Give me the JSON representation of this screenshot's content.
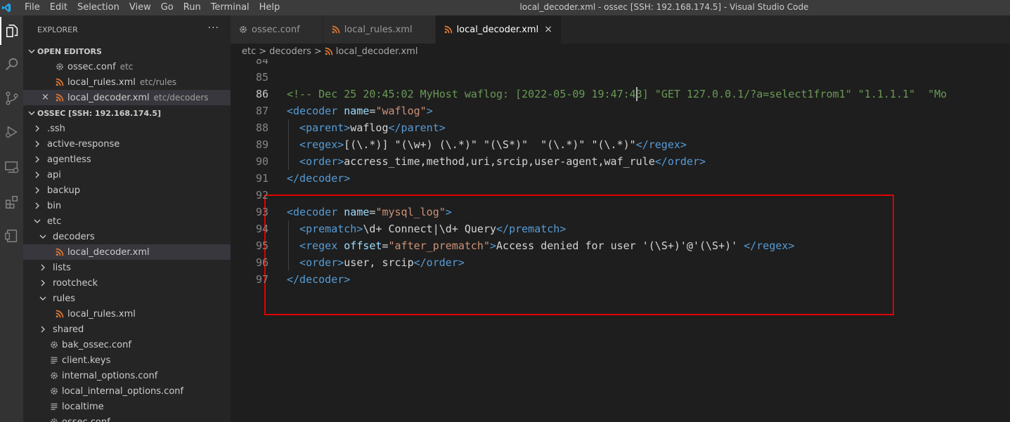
{
  "window": {
    "title": "local_decoder.xml - ossec [SSH: 192.168.174.5] - Visual Studio Code",
    "menu": [
      "File",
      "Edit",
      "Selection",
      "View",
      "Go",
      "Run",
      "Terminal",
      "Help"
    ]
  },
  "activity_bar": {
    "icons": [
      "explorer-icon",
      "search-icon",
      "source-control-icon",
      "run-debug-icon",
      "remote-explorer-icon",
      "extensions-icon",
      "remote-icon"
    ]
  },
  "sidebar": {
    "title": "EXPLORER",
    "more_actions": "···",
    "open_editors": {
      "label": "OPEN EDITORS",
      "items": [
        {
          "name": "ossec.conf",
          "desc": "etc",
          "icon": "gear-icon"
        },
        {
          "name": "local_rules.xml",
          "desc": "etc/rules",
          "icon": "rss-icon"
        },
        {
          "name": "local_decoder.xml",
          "desc": "etc/decoders",
          "icon": "rss-icon"
        }
      ]
    },
    "workspace": {
      "label": "OSSEC [SSH: 192.168.174.5]",
      "items": [
        {
          "name": ".ssh",
          "depth": 1,
          "type": "folder",
          "open": false
        },
        {
          "name": "active-response",
          "depth": 1,
          "type": "folder",
          "open": false
        },
        {
          "name": "agentless",
          "depth": 1,
          "type": "folder",
          "open": false
        },
        {
          "name": "api",
          "depth": 1,
          "type": "folder",
          "open": false
        },
        {
          "name": "backup",
          "depth": 1,
          "type": "folder",
          "open": false
        },
        {
          "name": "bin",
          "depth": 1,
          "type": "folder",
          "open": false
        },
        {
          "name": "etc",
          "depth": 1,
          "type": "folder",
          "open": true
        },
        {
          "name": "decoders",
          "depth": 2,
          "type": "folder",
          "open": true
        },
        {
          "name": "local_decoder.xml",
          "depth": 3,
          "type": "file",
          "icon": "rss-icon",
          "selected": true
        },
        {
          "name": "lists",
          "depth": 2,
          "type": "folder",
          "open": false
        },
        {
          "name": "rootcheck",
          "depth": 2,
          "type": "folder",
          "open": false
        },
        {
          "name": "rules",
          "depth": 2,
          "type": "folder",
          "open": true
        },
        {
          "name": "local_rules.xml",
          "depth": 3,
          "type": "file",
          "icon": "rss-icon"
        },
        {
          "name": "shared",
          "depth": 2,
          "type": "folder",
          "open": false
        },
        {
          "name": "bak_ossec.conf",
          "depth": 2,
          "type": "file",
          "icon": "gear-icon"
        },
        {
          "name": "client.keys",
          "depth": 2,
          "type": "file",
          "icon": "lines-icon"
        },
        {
          "name": "internal_options.conf",
          "depth": 2,
          "type": "file",
          "icon": "gear-icon"
        },
        {
          "name": "local_internal_options.conf",
          "depth": 2,
          "type": "file",
          "icon": "gear-icon"
        },
        {
          "name": "localtime",
          "depth": 2,
          "type": "file",
          "icon": "lines-icon"
        },
        {
          "name": "ossec.conf",
          "depth": 2,
          "type": "file",
          "icon": "gear-icon"
        }
      ]
    }
  },
  "tabs": [
    {
      "name": "ossec.conf",
      "icon": "gear-icon",
      "active": false
    },
    {
      "name": "local_rules.xml",
      "icon": "rss-icon",
      "active": false
    },
    {
      "name": "local_decoder.xml",
      "icon": "rss-icon",
      "active": true,
      "close": "×"
    }
  ],
  "breadcrumb": [
    "etc",
    "decoders",
    "local_decoder.xml"
  ],
  "breadcrumb_sep": ">",
  "editor": {
    "current_line": 86,
    "lines": [
      {
        "n": 84,
        "indent": 0,
        "tokens": []
      },
      {
        "n": 85,
        "indent": 0,
        "tokens": []
      },
      {
        "n": 86,
        "indent": 0,
        "tokens": [
          [
            "cmt",
            "<!-- Dec 25 20:45:02 MyHost waflog: [2022-05-09 19:47:43] \"GET 127.0.0.1/?a=select1from1\" \"1.1.1.1\"  \"Mo"
          ]
        ]
      },
      {
        "n": 87,
        "indent": 0,
        "tokens": [
          [
            "tag",
            "<decoder "
          ],
          [
            "attr",
            "name"
          ],
          [
            "plain",
            "="
          ],
          [
            "str",
            "\"waflog\""
          ],
          [
            "tag",
            ">"
          ]
        ]
      },
      {
        "n": 88,
        "indent": 1,
        "tokens": [
          [
            "tag",
            "<parent>"
          ],
          [
            "plain",
            "waflog"
          ],
          [
            "tag",
            "</parent>"
          ]
        ]
      },
      {
        "n": 89,
        "indent": 1,
        "tokens": [
          [
            "tag",
            "<regex>"
          ],
          [
            "plain",
            "[(\\.*)] \"(\\w+) (\\.*)\" \"(\\S*)\"  \"(\\.*)\" \"(\\.*)\""
          ],
          [
            "tag",
            "</regex>"
          ]
        ]
      },
      {
        "n": 90,
        "indent": 1,
        "tokens": [
          [
            "tag",
            "<order>"
          ],
          [
            "plain",
            "accress_time,method,uri,srcip,user-agent,waf_rule"
          ],
          [
            "tag",
            "</order>"
          ]
        ]
      },
      {
        "n": 91,
        "indent": 0,
        "tokens": [
          [
            "tag",
            "</decoder>"
          ]
        ]
      },
      {
        "n": 92,
        "indent": 0,
        "tokens": []
      },
      {
        "n": 93,
        "indent": 0,
        "tokens": [
          [
            "tag",
            "<decoder "
          ],
          [
            "attr",
            "name"
          ],
          [
            "plain",
            "="
          ],
          [
            "str",
            "\"mysql_log\""
          ],
          [
            "tag",
            ">"
          ]
        ]
      },
      {
        "n": 94,
        "indent": 1,
        "tokens": [
          [
            "tag",
            "<prematch>"
          ],
          [
            "plain",
            "\\d+ Connect|\\d+ Query"
          ],
          [
            "tag",
            "</prematch>"
          ]
        ]
      },
      {
        "n": 95,
        "indent": 1,
        "tokens": [
          [
            "tag",
            "<regex "
          ],
          [
            "attr",
            "offset"
          ],
          [
            "plain",
            "="
          ],
          [
            "str",
            "\"after_prematch\""
          ],
          [
            "tag",
            ">"
          ],
          [
            "plain",
            "Access denied for user '(\\S+)'@'(\\S+)' "
          ],
          [
            "tag",
            "</regex>"
          ]
        ]
      },
      {
        "n": 96,
        "indent": 1,
        "tokens": [
          [
            "tag",
            "<order>"
          ],
          [
            "plain",
            "user, srcip"
          ],
          [
            "tag",
            "</order>"
          ]
        ]
      },
      {
        "n": 97,
        "indent": 0,
        "tokens": [
          [
            "tag",
            "</decoder>"
          ]
        ]
      }
    ]
  },
  "colors": {
    "accent_highlight": "#e00000",
    "vscode_blue": "#007acc",
    "xml_icon": "#e37933"
  }
}
